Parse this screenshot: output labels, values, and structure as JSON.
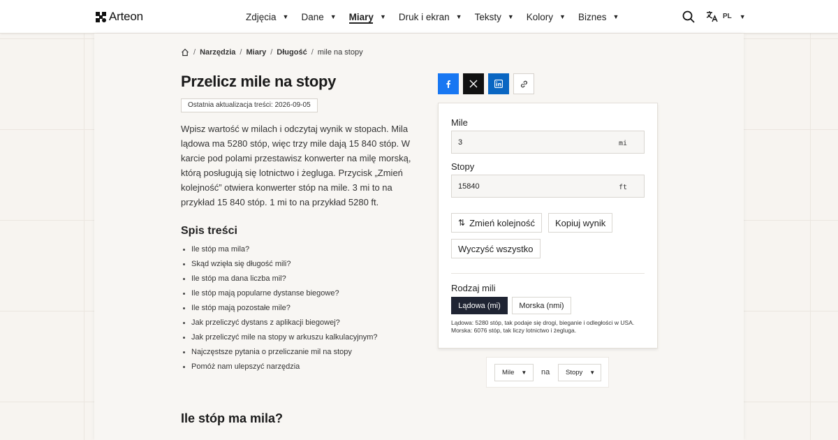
{
  "header": {
    "brand": "Arteon",
    "nav": [
      {
        "label": "Zdjęcia"
      },
      {
        "label": "Dane"
      },
      {
        "label": "Miary",
        "active": true
      },
      {
        "label": "Druk i ekran"
      },
      {
        "label": "Teksty"
      },
      {
        "label": "Kolory"
      },
      {
        "label": "Biznes"
      }
    ],
    "language": "PL",
    "icons": {
      "search": "search-icon",
      "language": "translate-icon",
      "home": "home-icon"
    }
  },
  "breadcrumb": {
    "items": [
      "Narzędzia",
      "Miary",
      "Długość"
    ],
    "current": "mile na stopy"
  },
  "page": {
    "title": "Przelicz mile na stopy",
    "updated": "Ostatnia aktualizacja treści: 2026-09-05",
    "intro": "Wpisz wartość w milach i odczytaj wynik w stopach. Mila lądowa ma 5280 stóp, więc trzy mile dają 15 840 stóp. W karcie pod polami przestawisz konwerter na milę morską, którą posługują się lotnictwo i żegluga. Przycisk „Zmień kolejność” otwiera konwerter stóp na mile. 3 mi to na przykład 15 840 stóp. 1 mi to na przykład 5280 ft.",
    "toc_title": "Spis treści",
    "toc": [
      "Ile stóp ma mila?",
      "Skąd wzięła się długość mili?",
      "Ile stóp ma dana liczba mil?",
      "Ile stóp mają popularne dystanse biegowe?",
      "Ile stóp mają pozostałe mile?",
      "Jak przeliczyć dystans z aplikacji biegowej?",
      "Jak przeliczyć mile na stopy w arkuszu kalkulacyjnym?",
      "Najczęstsze pytania o przeliczanie mil na stopy",
      "Pomóż nam ulepszyć narzędzia"
    ],
    "section_heading": "Ile stóp ma mila?"
  },
  "converter": {
    "from_label": "Mile",
    "from_value": "3",
    "from_unit": "mi",
    "to_label": "Stopy",
    "to_value": "15840",
    "to_unit": "ft",
    "swap_label": "Zmień kolejność",
    "copy_label": "Kopiuj wynik",
    "clear_label": "Wyczyść wszystko",
    "type_label": "Rodzaj mili",
    "type_options": [
      "Lądowa (mi)",
      "Morska (nmi)"
    ],
    "type_selected": "Lądowa (mi)",
    "note": "Lądowa: 5280 stóp, tak podaje się drogi, bieganie i odległości w USA. Morska: 6076 stóp, tak liczy lotnictwo i żegluga."
  },
  "unit_selector": {
    "from": "Mile",
    "connector": "na",
    "to": "Stopy"
  },
  "colors": {
    "facebook": "#1877f2",
    "x": "#111111",
    "linkedin": "#0a66c2",
    "active_segment": "#1f2433"
  }
}
